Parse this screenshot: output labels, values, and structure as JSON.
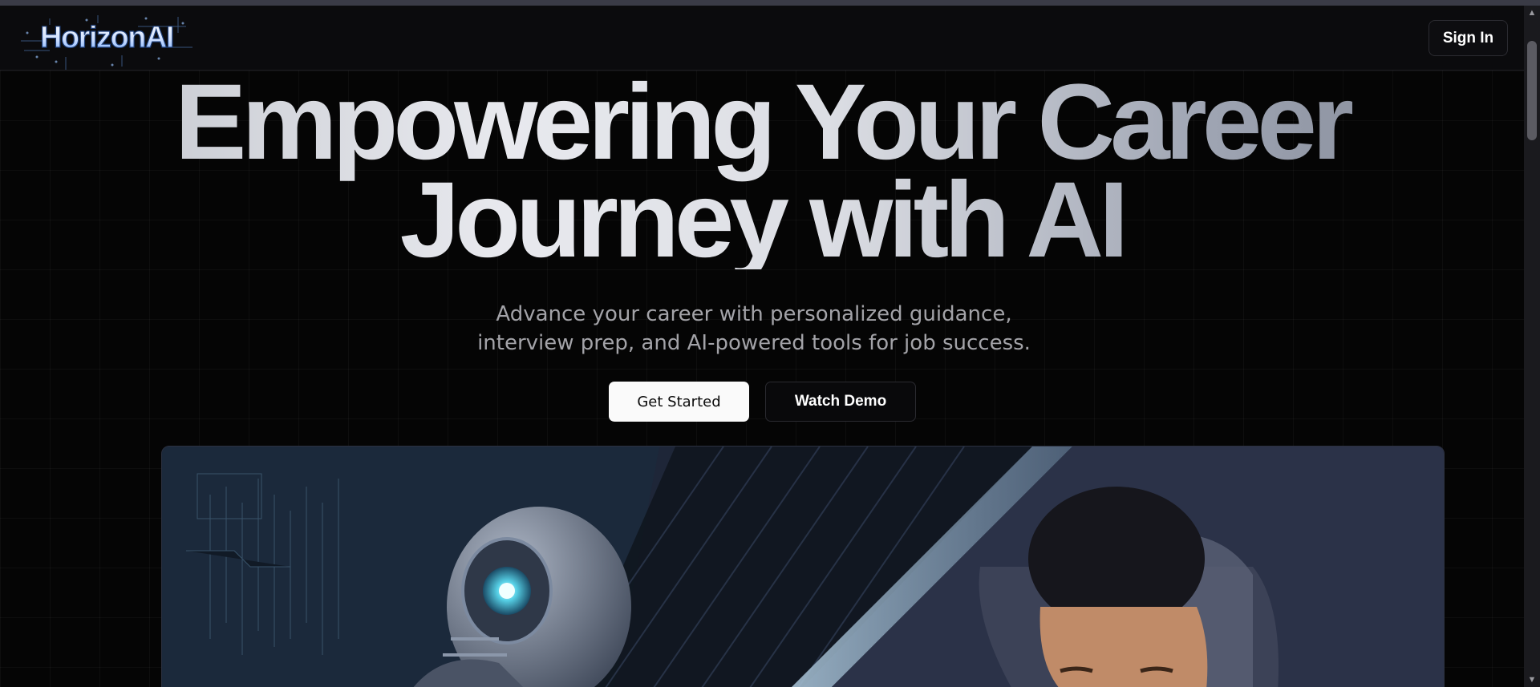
{
  "header": {
    "logo_text": "HorizonAI",
    "sign_in_label": "Sign In"
  },
  "hero": {
    "title_line1": "Empowering Your Career",
    "title_line2": "Journey with AI",
    "subtitle": "Advance your career with personalized guidance, interview prep, and AI-powered tools for job success.",
    "primary_cta": "Get Started",
    "secondary_cta": "Watch Demo",
    "image_alt": "humanoid-robot-and-person-illustration"
  },
  "colors": {
    "background": "#050505",
    "primary_button_bg": "#fafafa",
    "logo_accent": "#6fa8ff"
  },
  "scrollbar": {
    "up_icon": "triangle-up-icon",
    "down_icon": "triangle-down-icon"
  }
}
